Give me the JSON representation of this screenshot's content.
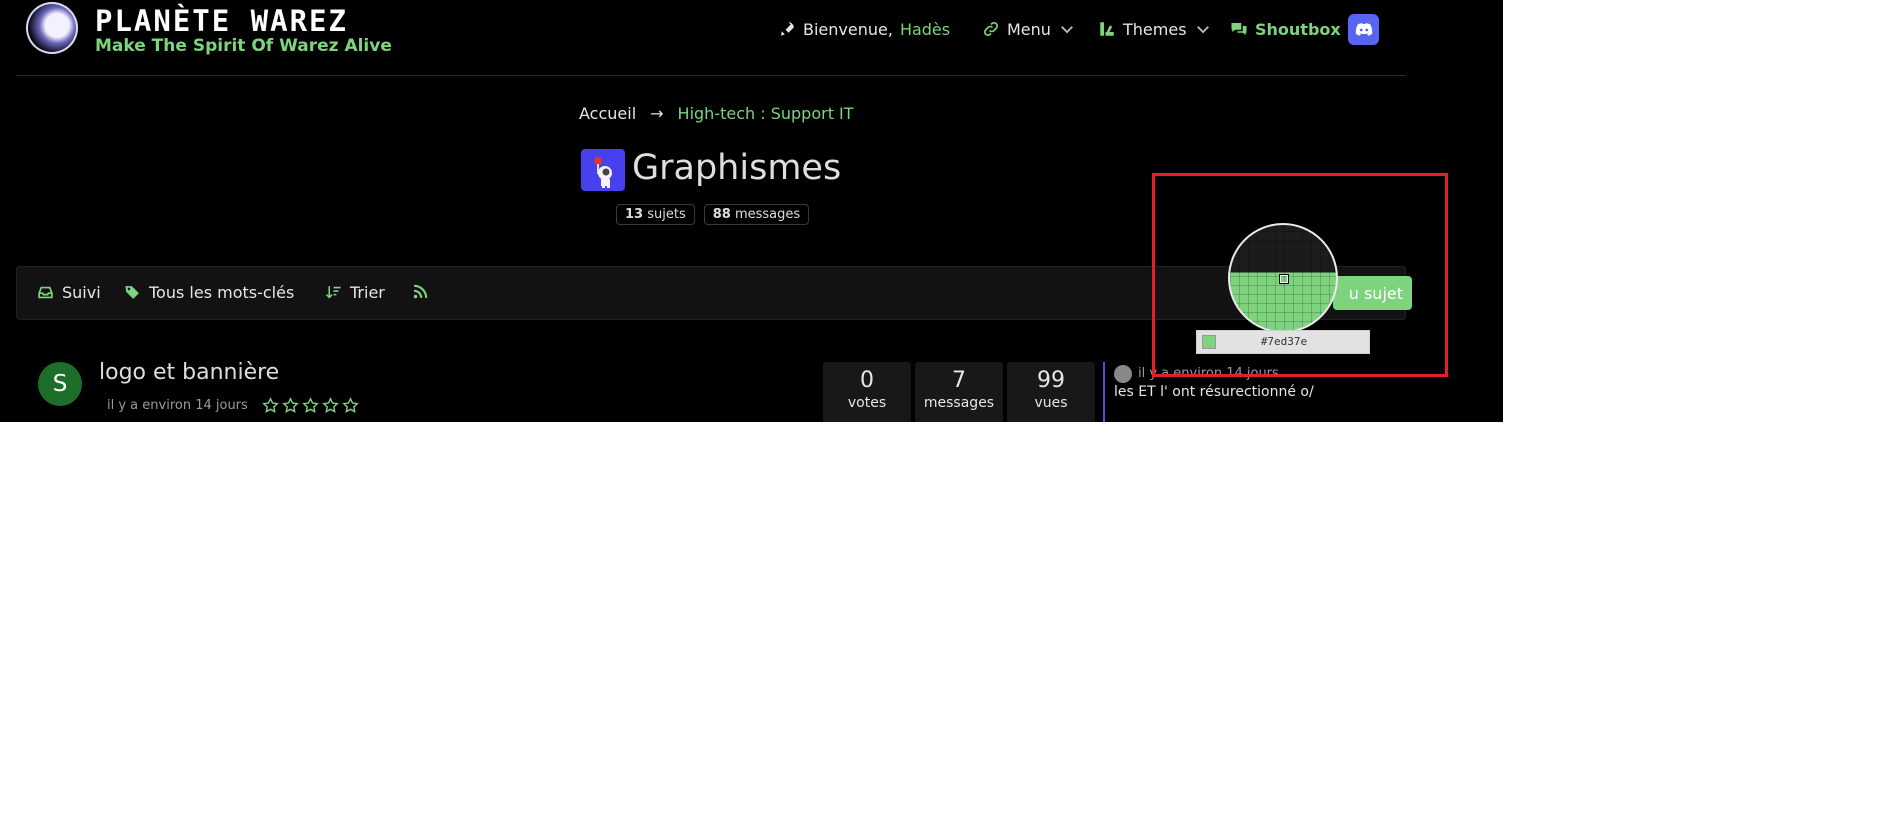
{
  "header": {
    "logo_title": "PLANÈTE WAREZ",
    "logo_subtitle": "Make The Spirit Of Warez Alive",
    "welcome_prefix": "Bienvenue,",
    "username": "Hadès",
    "menu_label": "Menu",
    "themes_label": "Themes",
    "shoutbox_label": "Shoutbox",
    "icons": {
      "welcome": "rocket-icon",
      "menu": "link-icon",
      "themes": "palette-icon",
      "shoutbox": "chat-icon",
      "discord": "discord-icon"
    }
  },
  "breadcrumb": {
    "home": "Accueil",
    "separator": "→",
    "current": "High-tech : Support IT"
  },
  "category": {
    "title": "Graphismes",
    "topics_count": "13",
    "topics_label": "sujets",
    "posts_count": "88",
    "posts_label": "messages"
  },
  "toolbar": {
    "watch": "Suivi",
    "tags": "Tous les mots-clés",
    "sort": "Trier",
    "new_topic": "u sujet"
  },
  "topics": [
    {
      "avatar_letter": "S",
      "title": "logo et bannière",
      "time": "il y a environ 14 jours",
      "rating_stars": 5,
      "rating_value": 0,
      "votes": "0",
      "votes_label": "votes",
      "posts": "7",
      "posts_label": "messages",
      "views": "99",
      "views_label": "vues",
      "last_post_time": "il y a environ 14 jours",
      "last_post_text": "les ET l' ont résurectionné o/"
    }
  ],
  "color_picker": {
    "hex": "#7ed37e"
  },
  "colors": {
    "accent": "#7ed37e",
    "background": "#000000",
    "category_icon": "#4640ee",
    "discord": "#5865f2",
    "highlight": "#e3202a"
  }
}
